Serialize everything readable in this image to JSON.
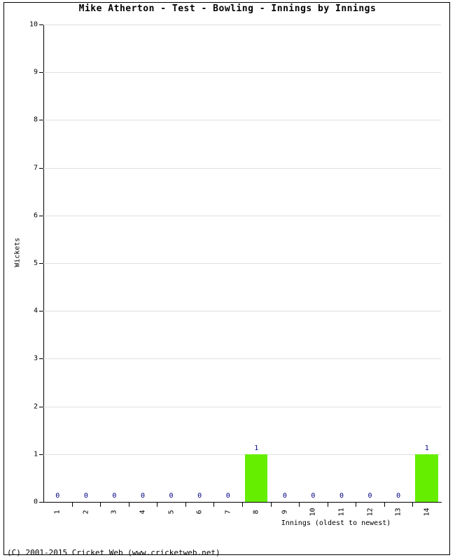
{
  "chart_data": {
    "type": "bar",
    "title": "Mike Atherton - Test - Bowling - Innings by Innings",
    "xlabel": "Innings (oldest to newest)",
    "ylabel": "Wickets",
    "categories": [
      "1",
      "2",
      "3",
      "4",
      "5",
      "6",
      "7",
      "8",
      "9",
      "10",
      "11",
      "12",
      "13",
      "14"
    ],
    "values": [
      0,
      0,
      0,
      0,
      0,
      0,
      0,
      1,
      0,
      0,
      0,
      0,
      0,
      1
    ],
    "value_labels": [
      "0",
      "0",
      "0",
      "0",
      "0",
      "0",
      "0",
      "1",
      "0",
      "0",
      "0",
      "0",
      "0",
      "1"
    ],
    "ylim": [
      0,
      10
    ],
    "yticks": [
      0,
      1,
      2,
      3,
      4,
      5,
      6,
      7,
      8,
      9,
      10
    ],
    "ytick_labels": [
      "0",
      "1",
      "2",
      "3",
      "4",
      "5",
      "6",
      "7",
      "8",
      "9",
      "10"
    ],
    "grid": true,
    "legend": false,
    "bar_color": "#66EE00",
    "value_label_color": "#00007f",
    "gridline_color": "#e0e0e0",
    "axis_color": "#000000"
  },
  "footer": {
    "copyright": "(C) 2001-2015 Cricket Web (www.cricketweb.net)"
  }
}
